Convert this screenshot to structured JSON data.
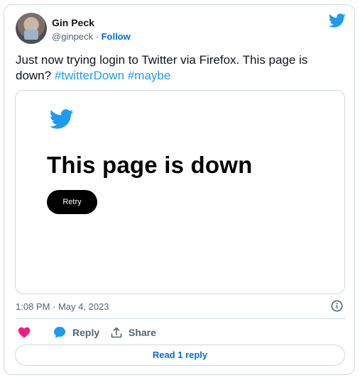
{
  "author": {
    "display_name": "Gin Peck",
    "handle": "@ginpeck",
    "separator": " · ",
    "follow_label": "Follow"
  },
  "tweet": {
    "text_prefix": "Just now trying login to Twitter via Firefox. This page is down? ",
    "hashtags": [
      "#twitterDown",
      "#maybe"
    ]
  },
  "media": {
    "headline": "This page is down",
    "retry_label": "Retry"
  },
  "meta": {
    "timestamp": "1:08 PM · May 4, 2023"
  },
  "actions": {
    "reply_label": "Reply",
    "share_label": "Share"
  },
  "footer": {
    "read_replies_label": "Read 1 reply"
  },
  "colors": {
    "twitter_blue": "#1d9bf0",
    "link_blue": "#006fd6",
    "like_pink": "#f91880",
    "border": "#cfd9de",
    "muted_text": "#536471"
  },
  "icons": {
    "brand": "twitter-bird-icon",
    "info": "info-icon",
    "like": "heart-icon",
    "reply": "speech-bubble-icon",
    "share": "share-upload-icon"
  }
}
